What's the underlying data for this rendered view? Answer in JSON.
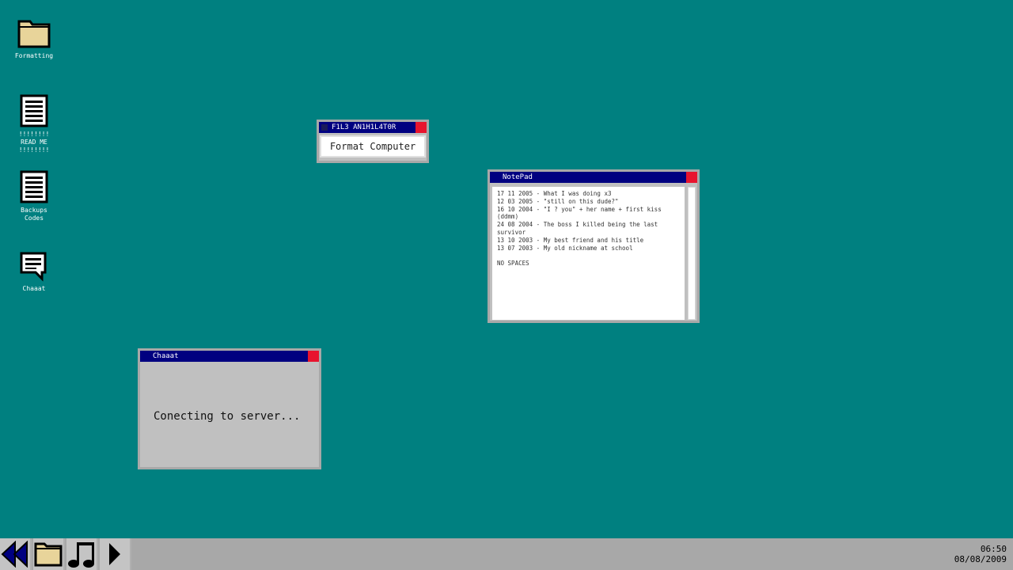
{
  "desktop": {
    "icons": [
      {
        "name": "folder-icon",
        "label": "Formatting"
      },
      {
        "name": "document-icon",
        "label": "!!!!!!!!\nREAD ME\n!!!!!!!!"
      },
      {
        "name": "document-icon",
        "label": "Backups\nCodes"
      },
      {
        "name": "chat-icon",
        "label": "Chaaat"
      }
    ]
  },
  "annihilator": {
    "title": "F1L3 AN1H1L4T0R",
    "button_label": "Format Computer"
  },
  "notepad": {
    "title": "NotePad",
    "lines": [
      "17 11 2005 - What I was doing x3",
      "12 03 2005 - \"still on this dude?\"",
      "16 10 2004 - \"I ? you\" + her name + first kiss (ddmm)",
      "24 08 2004 - The boss I killed being the last survivor",
      "13 10 2003 - My best friend and his title",
      "13 07 2003 - My old nickname at school",
      "",
      "NO SPACES"
    ]
  },
  "chat": {
    "title": "Chaaat",
    "status": "Conecting to server..."
  },
  "taskbar": {
    "time": "06:50",
    "date": "08/08/2009"
  },
  "colors": {
    "desktop": "#008080",
    "titlebar": "#000080",
    "close": "#e8142e",
    "window": "#c0c0c0",
    "taskbar": "#a8a8a8"
  }
}
